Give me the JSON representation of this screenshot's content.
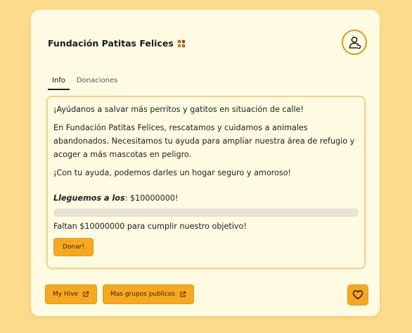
{
  "header": {
    "title": "Fundación Patitas Felices",
    "title_icon": "paw-icon",
    "avatar_icon": "user-icon"
  },
  "tabs": [
    {
      "label": "Info",
      "active": true
    },
    {
      "label": "Donaciones",
      "active": false
    }
  ],
  "content": {
    "paragraph1": "¡Ayúdanos a salvar más perritos y gatitos en situación de calle!",
    "paragraph2": "En Fundación Patitas Felices, rescatamos y cuidamos a animales abandonados. Necesitamos tu ayuda para ampliar nuestra área de refugio y acoger a más mascotas en peligro.",
    "paragraph3": "¡Con tu ayuda, podemos darles un hogar seguro y amoroso!",
    "goal_label": "Lleguemos a los",
    "goal_value": ": $10000000!",
    "progress_fraction": 0.0,
    "remaining_text": "Faltan $10000000 para cumplir nuestro objetivo!",
    "donate_label": "Donar!"
  },
  "footer": {
    "my_hive_label": "My Hive",
    "public_groups_label": "Mas grupos publicos",
    "external_icon": "external-link-icon",
    "heart_icon": "heart-icon"
  },
  "colors": {
    "background": "#fcdc8c",
    "card": "#fffbe3",
    "accent": "#f7a823",
    "avatar_border": "#d99a18"
  }
}
